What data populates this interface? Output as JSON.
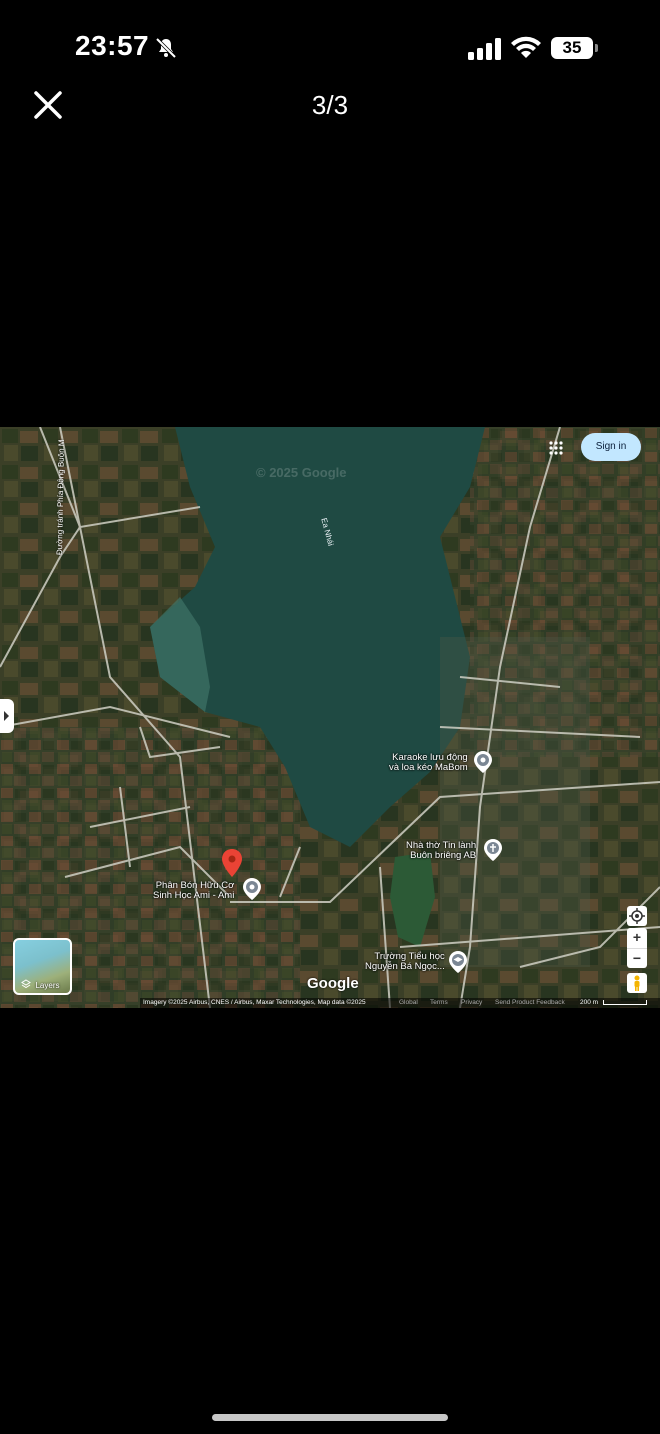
{
  "status_bar": {
    "time": "23:57",
    "battery_level": "35",
    "icons": [
      "bell-slash-icon",
      "cellular-signal-icon",
      "wifi-icon",
      "battery-icon"
    ]
  },
  "viewer": {
    "close_icon": "close-icon",
    "counter": "3/3"
  },
  "map": {
    "watermark": "© 2025 Google",
    "sign_in": "Sign in",
    "apps_icon": "apps-grid-icon",
    "water_label": "Ea Nhái",
    "road_label": "Đường tránh Phía Đông Buôn M",
    "selected_marker_icon": "red-location-pin-icon",
    "pois": [
      {
        "line1": "Karaoke lưu động",
        "line2": "và loa kéo MaBom",
        "icon": "place-icon"
      },
      {
        "line1": "Nhà thờ Tin lành",
        "line2": "Buôn briêng AB",
        "icon": "church-icon"
      },
      {
        "line1": "Phân Bón Hữu Cơ",
        "line2": "Sinh Học Ami - Ami",
        "icon": "place-icon"
      },
      {
        "line1": "Trường Tiểu học",
        "line2": "Nguyễn Bá Ngọc...",
        "icon": "school-icon"
      }
    ],
    "layers_label": "Layers",
    "controls": {
      "zoom_in": "+",
      "zoom_out": "−",
      "locate_icon": "my-location-icon",
      "pegman_icon": "pegman-icon"
    },
    "google_logo": "Google",
    "attribution": "Imagery ©2025 Airbus, CNES / Airbus, Maxar Technologies, Map data ©2025",
    "footer_links": [
      "Global",
      "Terms",
      "Privacy",
      "Send Product Feedback"
    ],
    "scale": "200 m"
  }
}
